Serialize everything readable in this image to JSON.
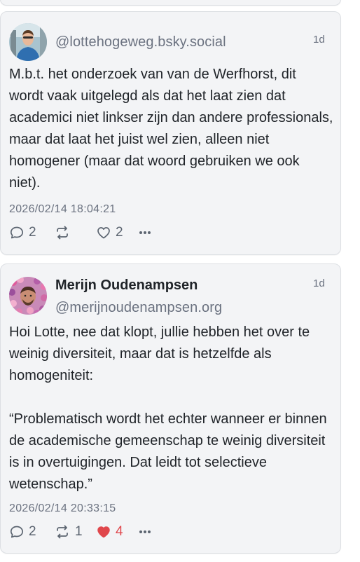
{
  "posts": [
    {
      "handle": "@lottehogeweg.bsky.social",
      "age": "1d",
      "text": "M.b.t. het onderzoek van van de Werfhorst, dit wordt vaak uitgelegd als dat het laat zien dat academici niet linkser zijn dan andere professionals, maar dat laat het juist wel zien, alleen niet homogener (maar dat woord gebruiken we ook niet).",
      "timestamp": "2026/02/14 18:04:21",
      "reply_count": "2",
      "repost_count": "",
      "like_count": "2",
      "liked": false,
      "avatar_icon": "person-photo-avatar"
    },
    {
      "display_name": "Merijn Oudenampsen",
      "handle": "@merijnoudenampsen.org",
      "age": "1d",
      "text": "Hoi Lotte, nee dat klopt, jullie hebben het over te weinig diversiteit, maar dat is hetzelfde als homogeniteit:\n\n“Problematisch wordt het echter wanneer er binnen de academische gemeenschap te weinig diversiteit is in overtuigingen. Dat leidt tot selectieve wetenschap.”",
      "timestamp": "2026/02/14 20:33:15",
      "reply_count": "2",
      "repost_count": "1",
      "like_count": "4",
      "liked": true,
      "avatar_icon": "person-in-ballpit-avatar"
    }
  ],
  "colors": {
    "card_bg": "#f3f4f6",
    "muted_text": "#6b7280",
    "like_active": "#e0474c",
    "body_text": "#1f2328"
  }
}
